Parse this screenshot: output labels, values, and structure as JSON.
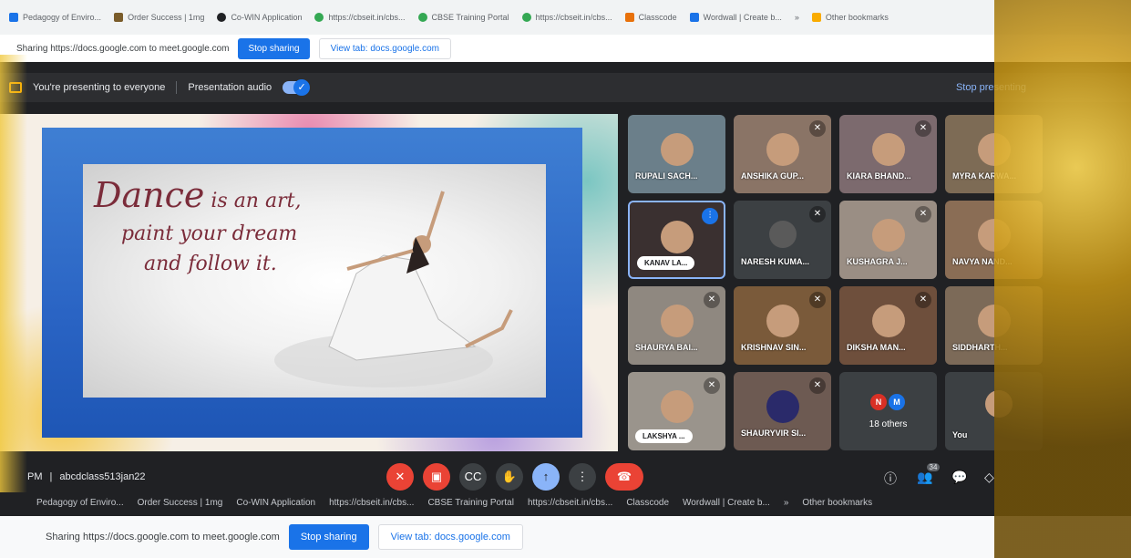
{
  "browser": {
    "bookmarks": [
      "Pedagogy of Enviro...",
      "Order Success | 1mg",
      "Co-WIN Application",
      "https://cbseit.in/cbs...",
      "CBSE Training Portal",
      "https://cbseit.in/cbs...",
      "Classcode",
      "Wordwall | Create b...",
      "»",
      "Other bookmarks"
    ],
    "sharing_text": "Sharing https://docs.google.com to meet.google.com",
    "stop_sharing": "Stop sharing",
    "view_tab": "View tab: docs.google.com"
  },
  "meet": {
    "presenting_text": "You're presenting to everyone",
    "presentation_audio": "Presentation audio",
    "stop_presenting": "Stop presenting",
    "slide": {
      "line1_big": "Dance",
      "line1_small": " is an art,",
      "line2": "paint your dream",
      "line3": "and follow it."
    },
    "participants": [
      {
        "name": "RUPALI SACH...",
        "muted": false
      },
      {
        "name": "ANSHIKA GUP...",
        "muted": true
      },
      {
        "name": "KIARA BHAND...",
        "muted": true
      },
      {
        "name": "MYRA KARWA...",
        "muted": false
      },
      {
        "name": "KANAV LA...",
        "muted": false,
        "speaking": true
      },
      {
        "name": "NARESH KUMA...",
        "muted": true
      },
      {
        "name": "KUSHAGRA J...",
        "muted": true
      },
      {
        "name": "NAVYA NAND...",
        "muted": false
      },
      {
        "name": "SHAURYA BAI...",
        "muted": true
      },
      {
        "name": "KRISHNAV SIN...",
        "muted": true
      },
      {
        "name": "DIKSHA MAN...",
        "muted": true
      },
      {
        "name": "SIDDHARTH...",
        "muted": false
      },
      {
        "name": "LAKSHYA ...",
        "muted": true
      },
      {
        "name": "SHAURYVIR SI...",
        "muted": true
      }
    ],
    "others": {
      "avatars": [
        "N",
        "M"
      ],
      "label": "18 others"
    },
    "you_label": "You",
    "time": "PM",
    "meeting_code": "abcdclass513jan22",
    "people_count": "34"
  },
  "colors": {
    "accent": "#1a73e8",
    "danger": "#ea4335",
    "meet_bg": "#202124"
  }
}
